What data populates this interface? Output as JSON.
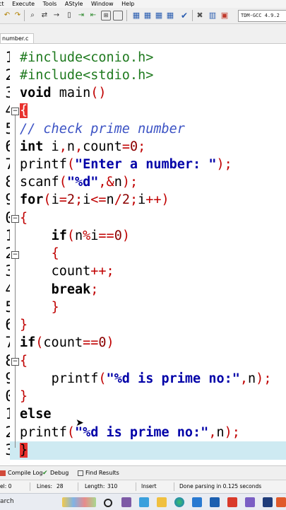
{
  "menu": {
    "items": [
      "ct",
      "Execute",
      "Tools",
      "AStyle",
      "Window",
      "Help"
    ]
  },
  "toolbar": {
    "compiler": "TDM-GCC 4.9.2"
  },
  "tab": {
    "filename": "number.c"
  },
  "editor": {
    "line_numbers": [
      "1",
      "2",
      "3",
      "4",
      "5",
      "6",
      "7",
      "8",
      "9",
      "0",
      "1",
      "2",
      "3",
      "4",
      "5",
      "6",
      "7",
      "8",
      "9",
      "0",
      "1",
      "2",
      "3"
    ],
    "lines": [
      "#include<conio.h>",
      "#include<stdio.h>",
      "void main()",
      "{",
      "// check prime number",
      "int i,n,count=0;",
      "printf(\"Enter a number: \");",
      "scanf(\"%d\",&n);",
      "for(i=2;i<=n/2;i++)",
      "{",
      "    if(n%i==0)",
      "    {",
      "    count++;",
      "    break;",
      "    }",
      "}",
      "if(count==0)",
      "{",
      "    printf(\"%d is prime no:\",n);",
      "}",
      "else",
      "printf(\"%d is prime no:\",n);",
      "}"
    ],
    "tokens": {
      "l1": "#include<conio.h>",
      "l2": "#include<stdio.h>",
      "void": "void",
      "main": " main",
      "paren_open": "(",
      "paren_close": ")",
      "lbrace": "{",
      "rbrace": "}",
      "comment": "// check prime number",
      "int": "int",
      "i_var": " i",
      "comma": ",",
      "n_var": "n",
      "count_var": "count",
      "eq": "=",
      "zero": "0",
      "semi": ";",
      "printf": "printf",
      "str_enter": "\"Enter a number: \"",
      "scanf": "scanf",
      "str_d": "\"%d\"",
      "amp": "&",
      "for": "for",
      "i_plain": "i",
      "two": "2",
      "le": "<=",
      "slash": "/",
      "plusplus": "++",
      "if": "if",
      "pct": "%",
      "eqeq": "==",
      "break": "break",
      "else": "else",
      "str_prime": "\"%d is prime no:\""
    }
  },
  "bottom_tabs": [
    "Compile Log",
    "Debug",
    "Find Results"
  ],
  "status": {
    "col": "el:  0",
    "lines_label": "Lines:",
    "lines_value": "28",
    "length_label": "Length:",
    "length_value": "310",
    "mode": "Insert",
    "message": "Done parsing in 0.125 seconds"
  },
  "taskbar": {
    "search": "arch"
  }
}
